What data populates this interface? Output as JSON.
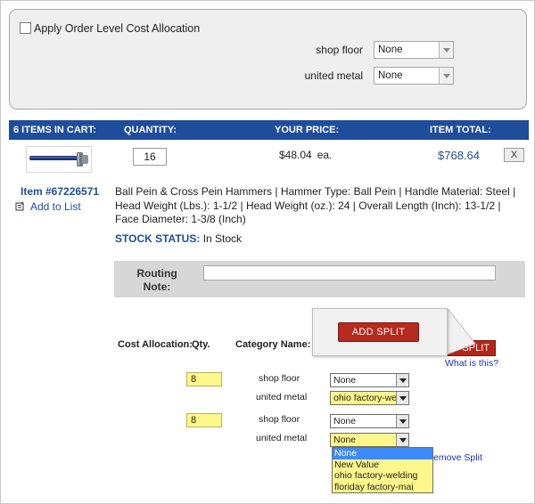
{
  "order_panel": {
    "checkbox_label": "Apply Order Level Cost Allocation",
    "allocations": [
      {
        "label": "shop floor",
        "value": "None"
      },
      {
        "label": "united metal",
        "value": "None"
      }
    ]
  },
  "cart_header": {
    "items": "6 ITEMS IN CART:",
    "quantity": "QUANTITY:",
    "price": "YOUR PRICE:",
    "total": "ITEM TOTAL:"
  },
  "item": {
    "quantity": "16",
    "price": "$48.04",
    "price_unit": "ea.",
    "total": "$768.64",
    "remove_label": "X",
    "number": "Item #67226571",
    "add_to_list": "Add to List",
    "description": "Ball Pein & Cross Pein Hammers | Hammer Type: Ball Pein | Handle Material: Steel | Head Weight (Lbs.): 1-1/2 | Head Weight (oz.): 24 | Overall Length (Inch): 13-1/2 | Face Diameter: 1-3/8 (Inch)",
    "stock_label": "STOCK STATUS:",
    "stock_value": "In Stock"
  },
  "routing": {
    "label_line1": "Routing",
    "label_line2": "Note:",
    "value": ""
  },
  "cost_allocation": {
    "label": "Cost Allocation:",
    "qty_label": "Qty.",
    "category_label": "Category Name:",
    "add_split_label": "ADD SPLIT",
    "add_split_partial": "SPLIT",
    "what_is_this": "What is this?",
    "remove_split_partial": "emove Split",
    "splits": [
      {
        "qty": "8",
        "rows": [
          {
            "name": "shop floor",
            "value": "None"
          },
          {
            "name": "united metal",
            "value": "ohio factory-we"
          }
        ]
      },
      {
        "qty": "8",
        "rows": [
          {
            "name": "shop floor",
            "value": "None"
          },
          {
            "name": "united metal",
            "value": "None"
          }
        ]
      }
    ],
    "dropdown_options": [
      "None",
      "New Value",
      "ohio factory-welding",
      "floriday factory-mai"
    ]
  },
  "colors": {
    "header_blue": "#1f4d9b",
    "button_red": "#b72a1e",
    "highlight_yellow": "#fff78a",
    "option_highlight": "#3b8bff"
  }
}
